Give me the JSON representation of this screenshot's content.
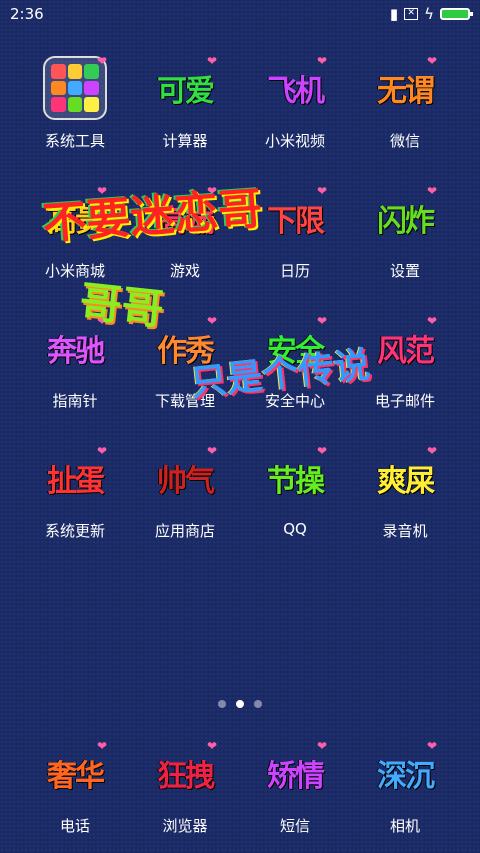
{
  "status": {
    "time": "2:36",
    "battery_color": "#2ecc40"
  },
  "apps": [
    {
      "label": "系统工具",
      "folder": true
    },
    {
      "label": "计算器",
      "text": "可爱",
      "color": "#33dd44"
    },
    {
      "label": "小米视频",
      "text": "飞机",
      "color": "#cc44ff"
    },
    {
      "label": "微信",
      "text": "无谓",
      "color": "#ff8822"
    },
    {
      "label": "小米商城",
      "text": "高贵",
      "color": "#ffcc22"
    },
    {
      "label": "游戏",
      "text": "高端",
      "color": "#ff3366"
    },
    {
      "label": "日历",
      "text": "下限",
      "color": "#ff4444"
    },
    {
      "label": "设置",
      "text": "闪炸",
      "color": "#66dd22"
    },
    {
      "label": "指南针",
      "text": "奔驰",
      "color": "#dd55ff"
    },
    {
      "label": "下载管理",
      "text": "作秀",
      "color": "#ff8833"
    },
    {
      "label": "安全中心",
      "text": "安全",
      "color": "#33ee33"
    },
    {
      "label": "电子邮件",
      "text": "风范",
      "color": "#ff3377"
    },
    {
      "label": "系统更新",
      "text": "扯蛋",
      "color": "#ff3333"
    },
    {
      "label": "应用商店",
      "text": "帅气",
      "color": "#cc2222"
    },
    {
      "label": "QQ",
      "text": "节操",
      "color": "#66ee22"
    },
    {
      "label": "录音机",
      "text": "爽屎",
      "color": "#ffee33"
    }
  ],
  "overlays": [
    {
      "text": "不要迷恋哥",
      "color": "#ff2222"
    },
    {
      "text": "哥哥",
      "color": "#88ee22"
    },
    {
      "text": "只是个传说",
      "color": "#3399ff"
    }
  ],
  "dock": [
    {
      "label": "电话",
      "text": "奢华",
      "color": "#ff6622"
    },
    {
      "label": "浏览器",
      "text": "狂拽",
      "color": "#ee2244"
    },
    {
      "label": "短信",
      "text": "矫情",
      "color": "#cc44ff"
    },
    {
      "label": "相机",
      "text": "深沉",
      "color": "#44aaff"
    }
  ],
  "folder_colors": [
    "#ff5555",
    "#ffcc33",
    "#33cc55",
    "#ff8822",
    "#44aaff",
    "#cc44ff",
    "#ff3377",
    "#66dd22",
    "#ffee44"
  ],
  "page_indicator": {
    "count": 3,
    "active_index": 1
  }
}
